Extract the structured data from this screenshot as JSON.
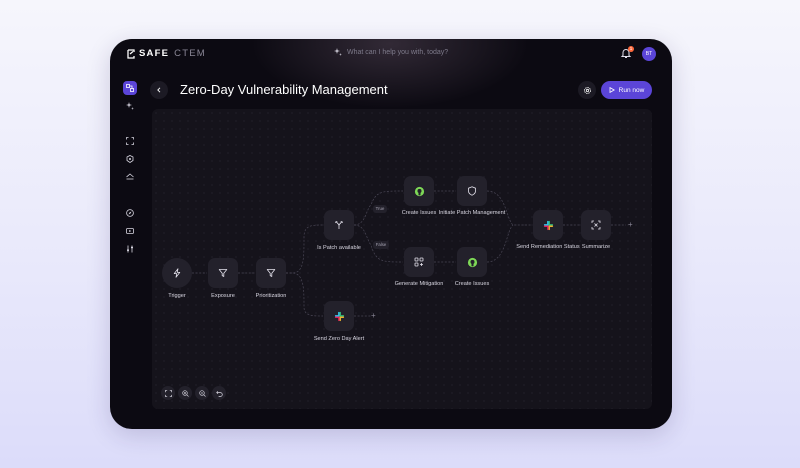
{
  "app": {
    "logo_primary": "SAFE",
    "logo_secondary": "CTEM",
    "search_placeholder": "What can I help you with, today?",
    "notification_count": "1",
    "avatar_initials": "BT"
  },
  "header": {
    "title": "Zero-Day Vulnerability Management",
    "run_label": "Run now"
  },
  "workflow": {
    "nodes": {
      "trigger": "Trigger",
      "exposure": "Exposure",
      "prioritization": "Prioritization",
      "is_patch_available": "Is Patch available",
      "send_zero_day_alert": "Send Zero Day Alert",
      "create_issues_top": "Create Issues",
      "initiate_patch_management": "Initiate Patch Management",
      "generate_mitigation": "Generate Mitigation",
      "create_issues_bottom": "Create Issues",
      "send_remediation_status": "Send Remediation Status",
      "summarize": "Summarize"
    },
    "branch_true": "True",
    "branch_false": "False"
  },
  "colors": {
    "accent": "#5b45d8",
    "frame": "#0c0a12",
    "canvas": "#15131b",
    "node": "#23212b",
    "github_green": "#7ed957",
    "notification": "#ff6a3d"
  },
  "icons": {
    "sidebar": [
      "workflow-icon",
      "sparkle-icon",
      "scan-icon",
      "target-icon",
      "cloud-icon",
      "compass-icon",
      "video-icon",
      "sliders-icon"
    ],
    "nodes": [
      "lightning-icon",
      "filter-icon",
      "filter-icon",
      "branch-icon",
      "slack-icon",
      "github-icon",
      "shield-icon",
      "grid-plus-icon",
      "github-icon",
      "slack-icon",
      "focus-icon"
    ],
    "zoom_controls": [
      "fit-screen-icon",
      "zoom-in-icon",
      "zoom-out-icon",
      "undo-icon"
    ]
  }
}
